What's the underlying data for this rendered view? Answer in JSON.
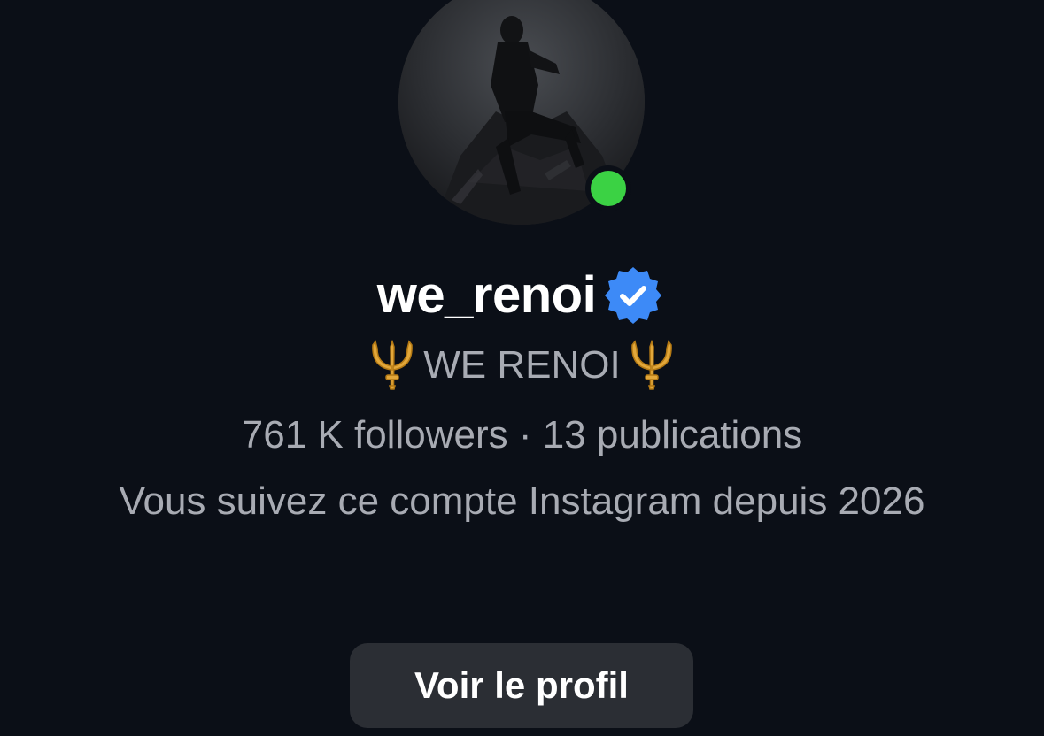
{
  "profile": {
    "username": "we_renoi",
    "verified": true,
    "online": true,
    "full_name": "WE RENOI",
    "full_name_icon": "trident-icon",
    "stats": "761 K followers · 13 publications",
    "follow_since": "Vous suivez ce compte Instagram depuis 2026"
  },
  "actions": {
    "view_profile_label": "Voir le profil"
  },
  "colors": {
    "background": "#0b0f17",
    "secondary_text": "#a8abb3",
    "verified_badge": "#3d8af7",
    "online_dot": "#3bd244",
    "button_bg": "#2b2e34"
  }
}
